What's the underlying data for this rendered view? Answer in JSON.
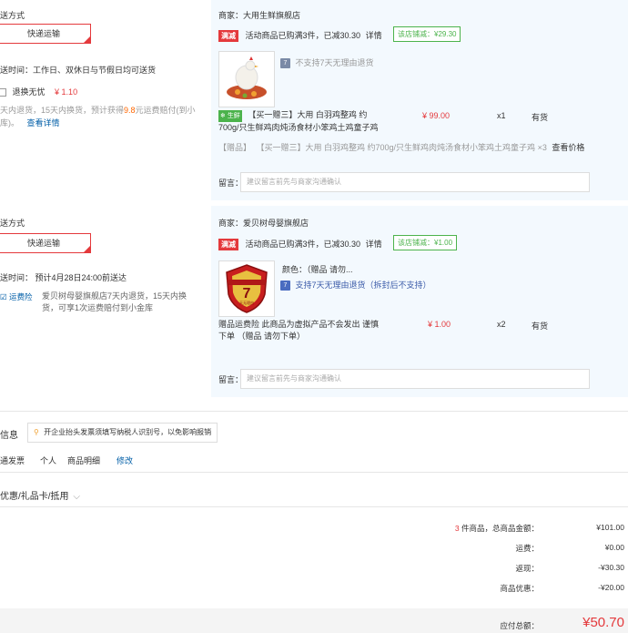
{
  "shop1": {
    "shipping_title": "送方式",
    "shipping_option": "快递运输",
    "delivery_time": "送时间：工作日、双休日与节假日均可送货",
    "return_check_label": "退换无忧",
    "return_price": "¥ 1.10",
    "return_desc_prefix": "天内退货，15天内换货，预计获得",
    "return_desc_highlight": "9.8",
    "return_desc_suffix": "元运费赔付(到小",
    "return_desc_line2": "库)。",
    "return_detail_link": "查看详情",
    "merchant": "商家：大用生鲜旗舰店",
    "promo_tag": "满减",
    "promo_text": "活动商品已购满3件，已减30.30",
    "promo_link": "详情",
    "discount_badge": "该店铺减：¥29.30",
    "no_return_text": "不支持7天无理由退货",
    "fresh_tag": "生鲜",
    "product_name_line1": "【买一赠三】大用 白羽鸡整鸡 约",
    "product_name_line2": "700g/只生鲜鸡肉炖汤食材小笨鸡土鸡童子鸡",
    "product_price": "¥ 99.00",
    "product_qty": "x1",
    "product_stock": "有货",
    "gift_label": "【赠品】",
    "gift_text": "【买一赠三】大用 白羽鸡整鸡 约700g/只生鲜鸡肉炖汤食材小笨鸡土鸡童子鸡",
    "gift_qty": "×3",
    "gift_link": "查看价格",
    "note_label": "留言：",
    "note_placeholder": "建议留言前先与商家沟通确认"
  },
  "shop2": {
    "shipping_title": "送方式",
    "shipping_option": "快递运输",
    "delivery_time": "送时间：  预计4月28日24:00前送达",
    "insurance_tag": "运费险",
    "insurance_line1": "爱贝树母婴旗舰店7天内退货，15天内换",
    "insurance_line2": "货，可享1次运费赔付到小金库",
    "merchant": "商家：爱贝树母婴旗舰店",
    "promo_tag": "满减",
    "promo_text": "活动商品已购满3件，已减30.30",
    "promo_link": "详情",
    "discount_badge": "该店铺减：¥1.00",
    "color_label": "颜色：（赠品 请勿...",
    "return_support": "支持7天无理由退货（拆封后不支持）",
    "badge_number": "7",
    "badge_sub": "天无理由",
    "product_name_line1": "赠品运费险 此商品为虚拟产品不会发出 谨慎",
    "product_name_line2": "下单 （赠品 请勿下单）",
    "product_price": "¥ 1.00",
    "product_qty": "x2",
    "product_stock": "有货",
    "note_label": "留言：",
    "note_placeholder": "建议留言前先与商家沟通确认"
  },
  "invoice": {
    "title": "信息",
    "hint": "开企业抬头发票须填写纳税人识别号，以免影响报销",
    "type": "通发票",
    "receiver": "个人",
    "content": "商品明细",
    "modify": "修改"
  },
  "coupon": {
    "label": "优惠/礼品卡/抵用"
  },
  "summary": {
    "count": "3",
    "count_label": "件商品，总商品金额：",
    "total_goods": "¥101.00",
    "shipping_label": "运费：",
    "shipping": "¥0.00",
    "cashback_label": "返现：",
    "cashback": "-¥30.30",
    "discount_label": "商品优惠：",
    "discount": "-¥20.00",
    "payable_label": "应付总额：",
    "payable": "¥50.70"
  },
  "colors": {
    "accent_red": "#e4393c",
    "link_blue": "#005ea7",
    "green": "#4cb34c",
    "panel_bg": "#f3f9fe"
  }
}
